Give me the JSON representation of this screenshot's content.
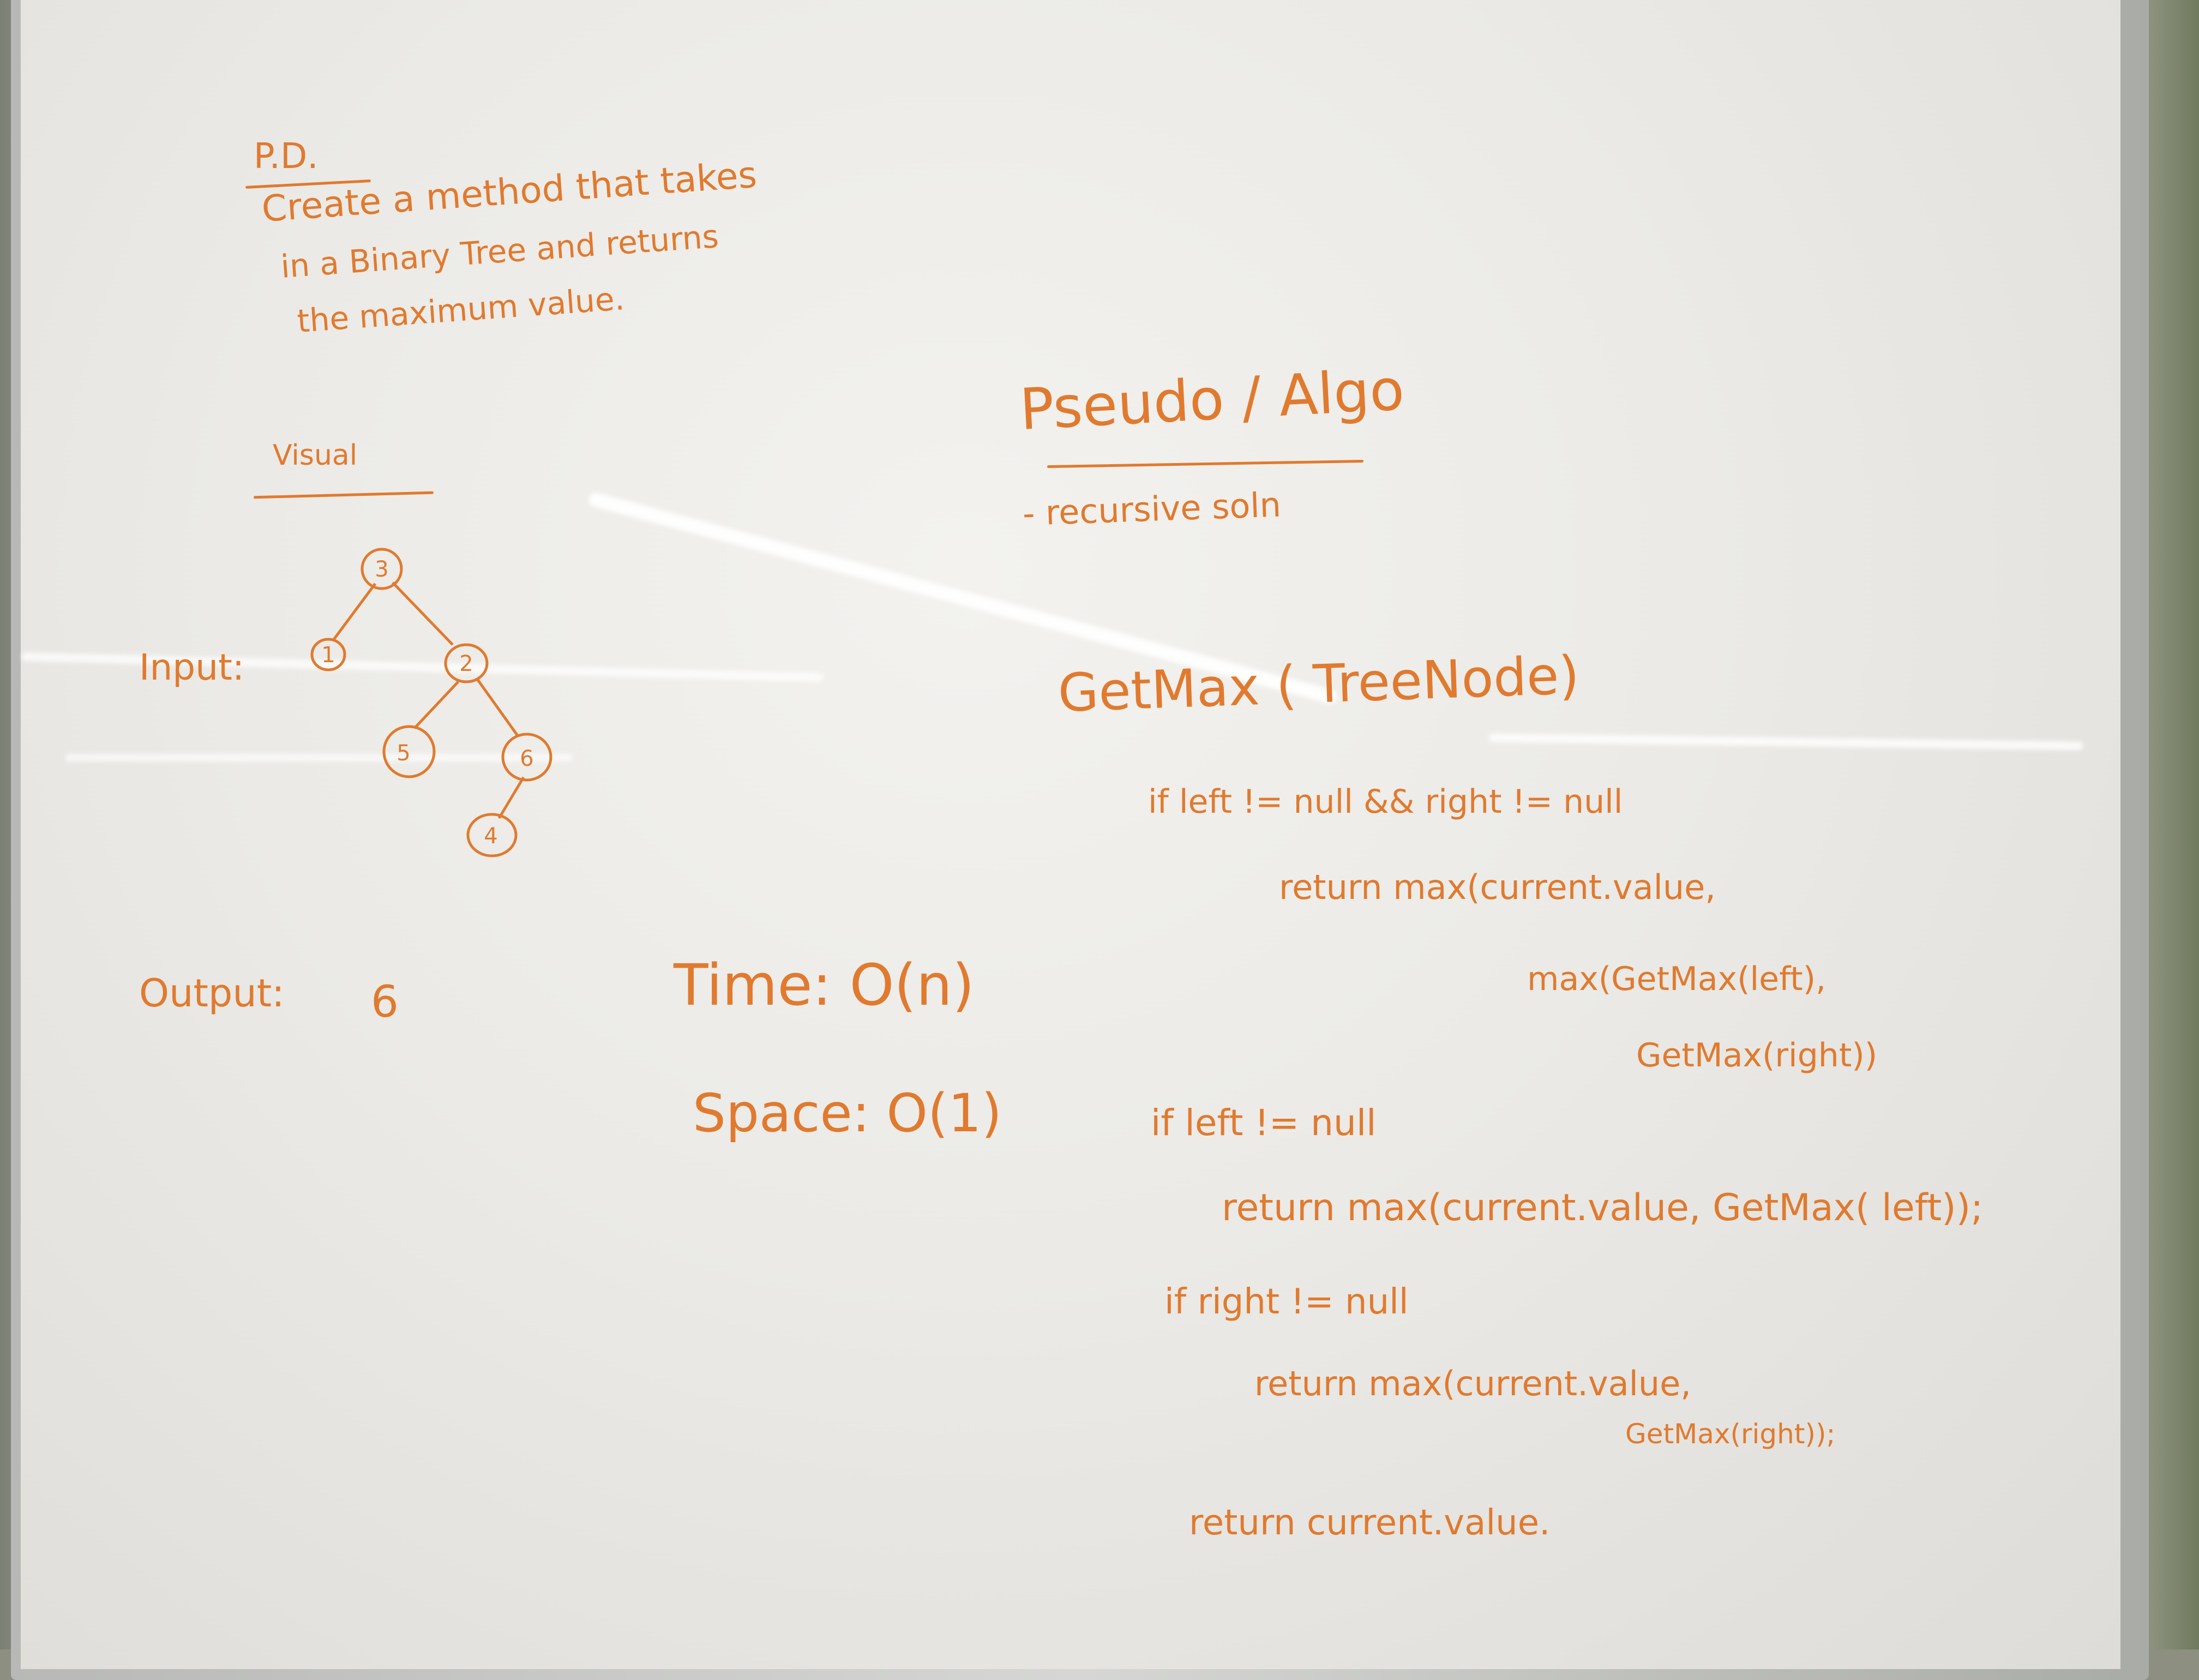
{
  "heading_pd": "P.D.",
  "problem": [
    "Create a method that takes",
    "in a Binary Tree and returns",
    "the maximum value."
  ],
  "visual_heading": "Visual",
  "input_label": "Input:",
  "tree_nodes": [
    "3",
    "1",
    "2",
    "5",
    "6",
    "4"
  ],
  "output_label": "Output:",
  "output_value": "6",
  "time": "Time: O(n)",
  "space": "Space: O(1)",
  "pseudo_heading": "Pseudo / Algo",
  "approach": "- recursive soln",
  "signature": "GetMax ( TreeNode)",
  "code": [
    "if left != null && right != null",
    "return max(current.value,",
    "max(GetMax(left),",
    "GetMax(right))",
    "if left != null",
    "return max(current.value, GetMax( left));",
    "if right != null",
    "return max(current.value,",
    "GetMax(right));",
    "return current.value."
  ],
  "colors": {
    "marker": "#e07a2f",
    "board": "#ebeae6"
  }
}
